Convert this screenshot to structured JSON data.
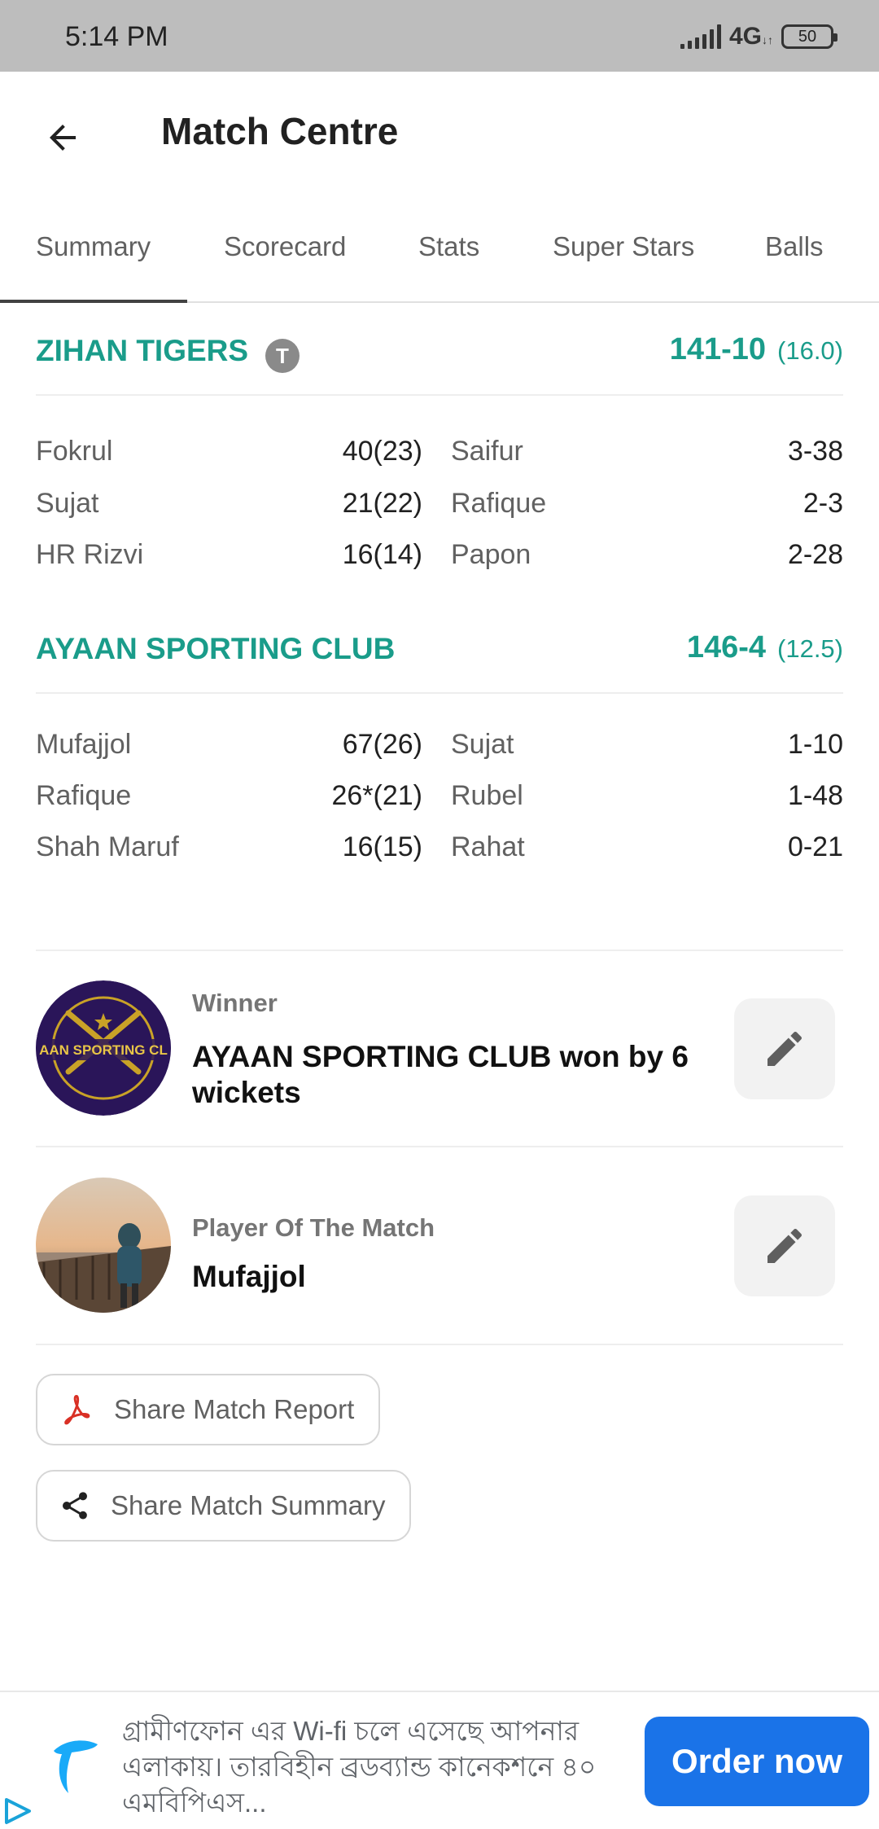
{
  "status_bar": {
    "time": "5:14 PM",
    "network": "4G",
    "battery": "50"
  },
  "app_bar": {
    "title": "Match Centre"
  },
  "tabs": [
    {
      "label": "Summary",
      "active": true
    },
    {
      "label": "Scorecard",
      "active": false
    },
    {
      "label": "Stats",
      "active": false
    },
    {
      "label": "Super Stars",
      "active": false
    },
    {
      "label": "Balls",
      "active": false
    }
  ],
  "innings": [
    {
      "team": "ZIHAN TIGERS",
      "toss_badge": "T",
      "score": "141-10",
      "overs": "(16.0)",
      "rows": [
        {
          "batter": "Fokrul",
          "bat_score": "40(23)",
          "bowler": "Saifur",
          "bowl_figures": "3-38"
        },
        {
          "batter": "Sujat",
          "bat_score": "21(22)",
          "bowler": "Rafique",
          "bowl_figures": "2-3"
        },
        {
          "batter": "HR Rizvi",
          "bat_score": "16(14)",
          "bowler": "Papon",
          "bowl_figures": "2-28"
        }
      ]
    },
    {
      "team": "AYAAN SPORTING CLUB",
      "score": "146-4",
      "overs": "(12.5)",
      "rows": [
        {
          "batter": "Mufajjol",
          "bat_score": "67(26)",
          "bowler": "Sujat",
          "bowl_figures": "1-10"
        },
        {
          "batter": "Rafique",
          "bat_score": "26*(21)",
          "bowler": "Rubel",
          "bowl_figures": "1-48"
        },
        {
          "batter": "Shah Maruf",
          "bat_score": "16(15)",
          "bowler": "Rahat",
          "bowl_figures": "0-21"
        }
      ]
    }
  ],
  "winner": {
    "label": "Winner",
    "result": "AYAAN SPORTING CLUB won by 6 wickets",
    "logo_text": "AAN SPORTING CL"
  },
  "player_of_match": {
    "label": "Player Of The Match",
    "name": "Mufajjol"
  },
  "share": {
    "report_label": "Share Match Report",
    "summary_label": "Share Match Summary"
  },
  "ad": {
    "text": "গ্রামীণফোন এর Wi-fi চলে এসেছে আপনার এলাকায়। তারবিহীন ব্রডব্যান্ড কানেকশনে ৪০ এমবিপিএস...",
    "cta": "Order now"
  },
  "colors": {
    "accent": "#1a9c8a",
    "ad_button": "#1a73e8"
  }
}
